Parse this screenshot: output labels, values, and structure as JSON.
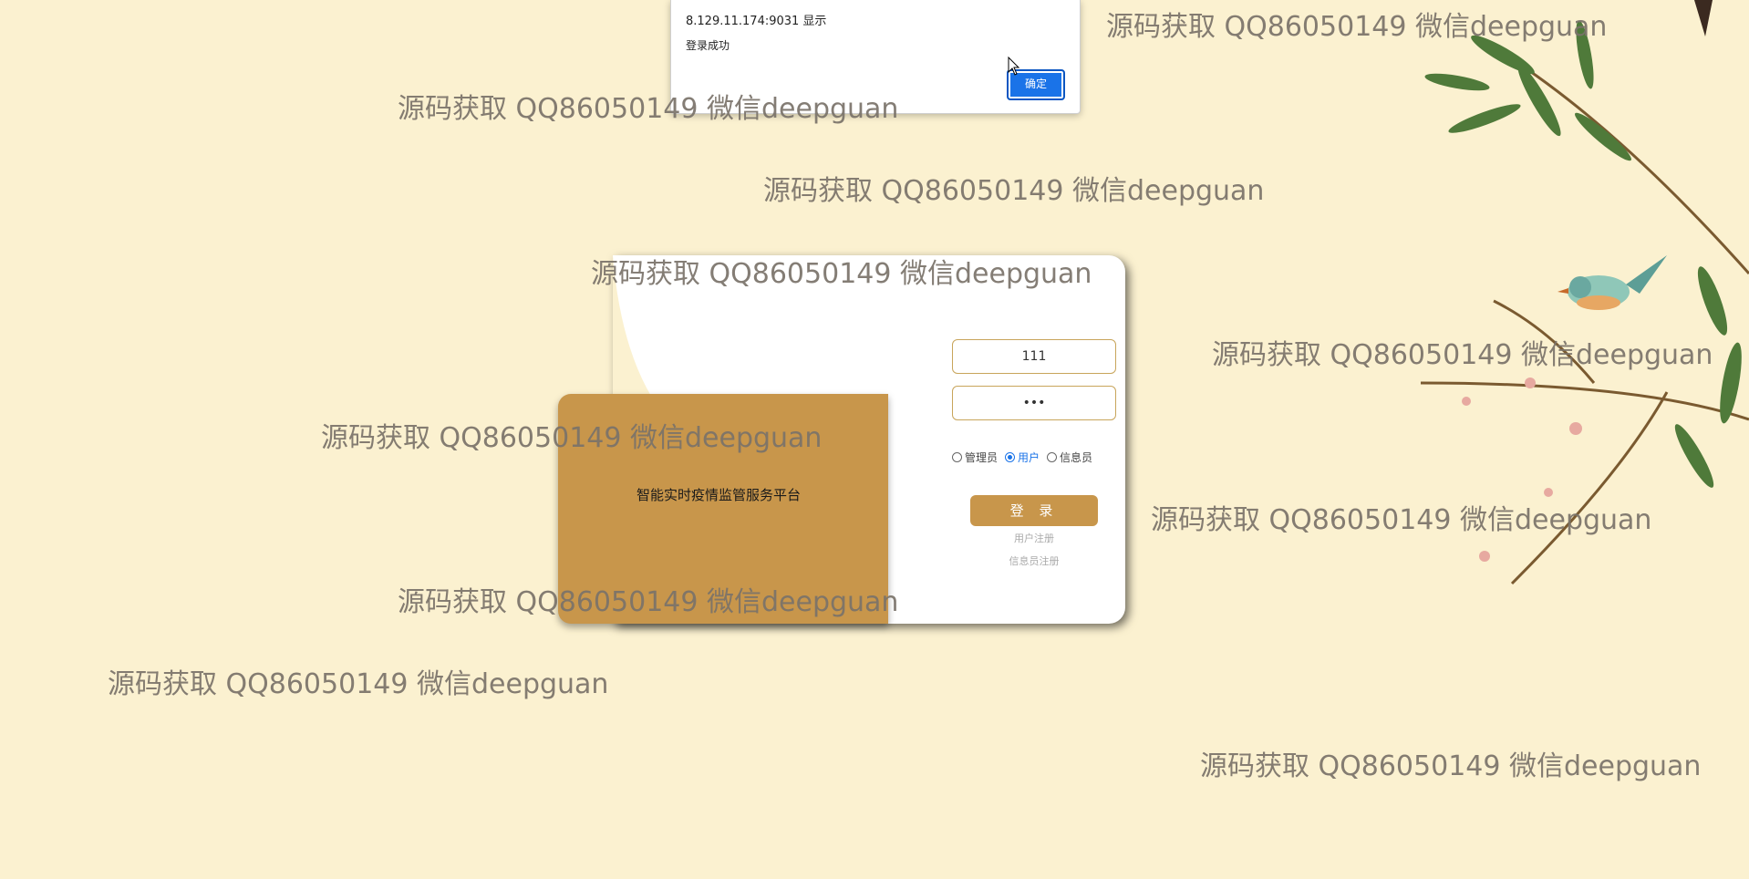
{
  "alert": {
    "origin": "8.129.11.174:9031 显示",
    "message": "登录成功",
    "ok_label": "确定"
  },
  "login": {
    "platform_title": "智能实时疫情监管服务平台",
    "username_value": "111",
    "password_value": "•••",
    "roles": [
      {
        "label": "管理员",
        "selected": false
      },
      {
        "label": "用户",
        "selected": true
      },
      {
        "label": "信息员",
        "selected": false
      }
    ],
    "login_label": "登 录",
    "register_user_label": "用户注册",
    "register_informant_label": "信息员注册"
  },
  "watermark": {
    "text": "源码获取 QQ86050149 微信deepguan"
  },
  "colors": {
    "background": "#fbf1d0",
    "accent_gold": "#c8964b",
    "dialog_button": "#1a73e8"
  }
}
